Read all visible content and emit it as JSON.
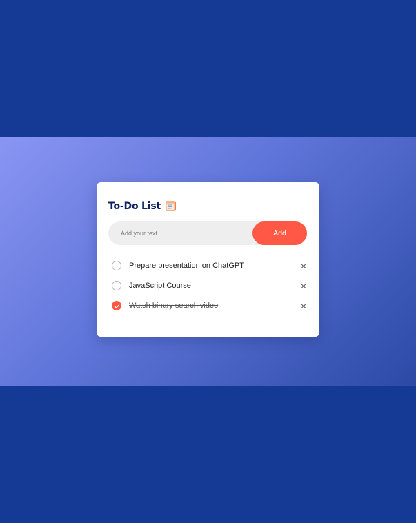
{
  "app": {
    "title": "To-Do List",
    "title_icon": "notepad-icon"
  },
  "input": {
    "placeholder": "Add your text",
    "value": "",
    "add_label": "Add"
  },
  "tasks": [
    {
      "label": "Prepare presentation on ChatGPT",
      "done": false,
      "delete_symbol": "×"
    },
    {
      "label": "JavaScript Course",
      "done": false,
      "delete_symbol": "×"
    },
    {
      "label": "Watch binary search video",
      "done": true,
      "delete_symbol": "×"
    }
  ],
  "colors": {
    "page_background": "#143a96",
    "gradient_start": "#8a95f3",
    "gradient_end": "#2b4aa6",
    "accent": "#ff5945",
    "title": "#0c2260"
  }
}
